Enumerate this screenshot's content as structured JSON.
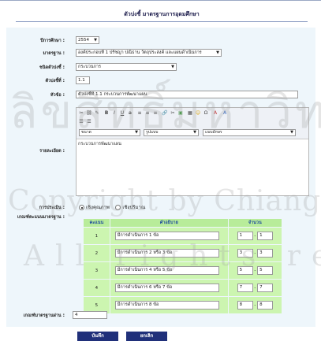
{
  "page": {
    "title": "ตัวบ่งชี้ มาตรฐานการอุดมศึกษา"
  },
  "form": {
    "year_label": "ปีการศึกษา",
    "year_value": "2554",
    "standard_label": "มาตรฐาน",
    "standard_value": "องค์ประกอบที่ 1 ปรัชญา ปณิธาน วัตถุประสงค์ และแผนดำเนินการ",
    "indicator_type_label": "ชนิดตัวบ่งชี้",
    "indicator_type_value": "กระบวนการ",
    "indicator_no_label": "ตัวบ่งชี้ที่",
    "indicator_no_value": "1.1",
    "topic_label": "หัวข้อ",
    "topic_value": "ตัวบ่งชี้ที่ 1.1 กระบวนการพัฒนาแผน",
    "detail_label": "รายละเอียด",
    "detail_value": "กระบวนการพัฒนาแผน",
    "assessment_label": "การประเมิน",
    "assessment_options": [
      "เชิงคุณภาพ",
      "เชิงปริมาณ"
    ],
    "assessment_selected": "เชิงคุณภาพ",
    "criteria_label": "เกณฑ์คะแนนมาตรฐาน",
    "target_label": "เกณฑ์มาตรฐานผ่าน",
    "target_value": "4"
  },
  "editor": {
    "size_label": "ขนาด",
    "format_label": "รูปแบบ",
    "font_label": "แบบอักษร"
  },
  "criteria_table": {
    "headers": [
      "คะแนน",
      "คำอธิบาย",
      "จำนวน"
    ],
    "rows": [
      {
        "score": "1",
        "desc": "มีการดำเนินการ 1 ข้อ",
        "from": "1",
        "to": "1"
      },
      {
        "score": "2",
        "desc": "มีการดำเนินการ 2 หรือ 3 ข้อ",
        "from": "3",
        "to": "3"
      },
      {
        "score": "3",
        "desc": "มีการดำเนินการ 4 หรือ 5 ข้อ",
        "from": "5",
        "to": "5"
      },
      {
        "score": "4",
        "desc": "มีการดำเนินการ 6 หรือ 7 ข้อ",
        "from": "7",
        "to": "7"
      },
      {
        "score": "5",
        "desc": "มีการดำเนินการ 8 ข้อ",
        "from": "8",
        "to": "8"
      }
    ]
  },
  "buttons": {
    "save": "บันทึก",
    "cancel": "ยกเลิก"
  },
  "watermark": {
    "line1": "ลิขสิทธิ์มหาวิทยาลัยเชียงใหม่",
    "line2": "Copyright by Chiang Mai University",
    "line3": "All rights reserved"
  },
  "colors": {
    "table_header": "#b8ec9a",
    "table_row": "#ccf5b0",
    "button": "#20307a",
    "form_bg": "#eef6fb"
  }
}
